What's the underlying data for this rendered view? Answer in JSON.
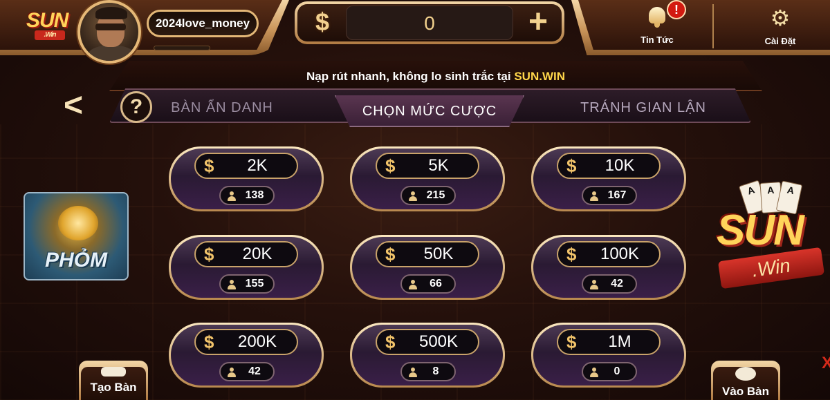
{
  "header": {
    "logo_text": "SUN",
    "logo_sub": ".Win",
    "username": "2024love_money",
    "balance": "0",
    "currency_symbol": "$",
    "add_symbol": "+",
    "news": {
      "label": "Tin Tức",
      "badge": "!"
    },
    "settings": {
      "label": "Cài Đặt"
    }
  },
  "marquee": {
    "text": "Nạp rút nhanh, không lo sinh trắc tại ",
    "highlight": "SUN.WIN"
  },
  "tabs": {
    "help": "?",
    "back": "<",
    "items": [
      "BÀN ẨN DANH",
      "CHỌN MỨC CƯỢC",
      "TRÁNH GIAN LẬN"
    ],
    "active": "CHỌN MỨC CƯỢC"
  },
  "bets": [
    {
      "value": "2K",
      "players": "138"
    },
    {
      "value": "5K",
      "players": "215"
    },
    {
      "value": "10K",
      "players": "167"
    },
    {
      "value": "20K",
      "players": "155"
    },
    {
      "value": "50K",
      "players": "66"
    },
    {
      "value": "100K",
      "players": "42"
    },
    {
      "value": "200K",
      "players": "42"
    },
    {
      "value": "500K",
      "players": "8"
    },
    {
      "value": "1M",
      "players": "0"
    }
  ],
  "side": {
    "game_name": "PHỎM",
    "brand": "SUN",
    "brand_sub": ".Win"
  },
  "bottom": {
    "create_label": "Tạo Bàn",
    "join_label": "Vào Bàn"
  },
  "colors": {
    "accent_gold": "#f1c36a",
    "highlight_yellow": "#ffd64a",
    "alert_red": "#d31a10"
  }
}
